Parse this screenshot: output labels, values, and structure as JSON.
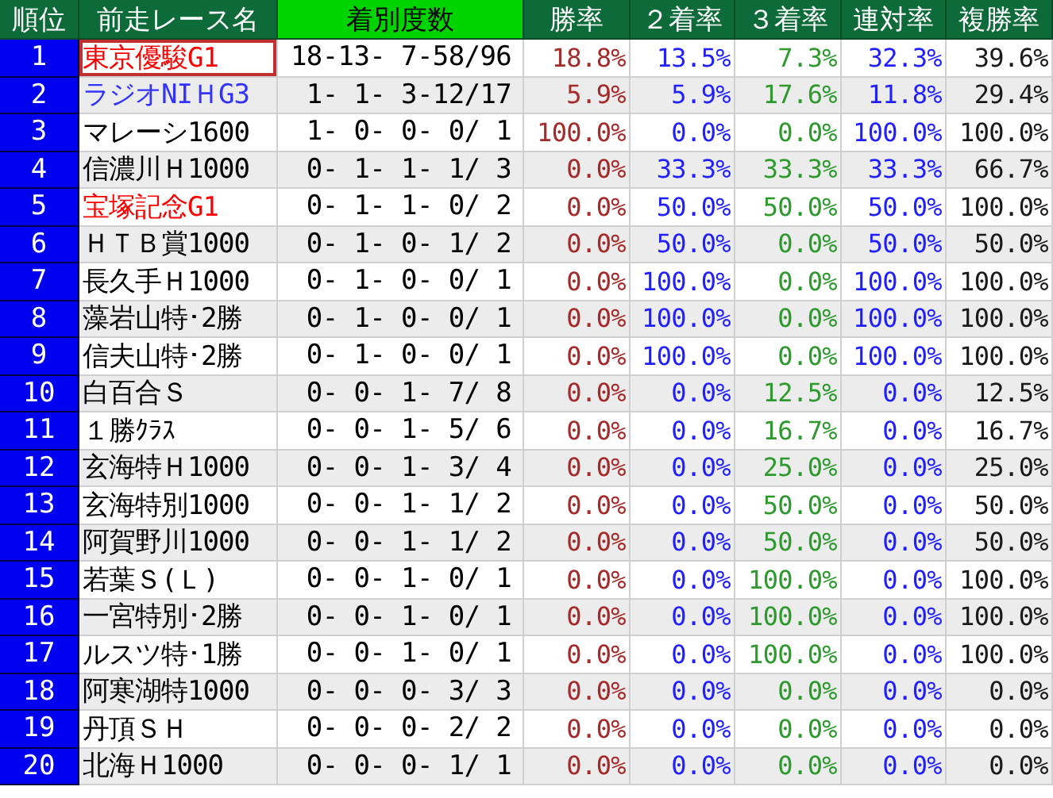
{
  "columns": [
    {
      "label": "順位",
      "sorted": false
    },
    {
      "label": "前走レース名",
      "sorted": false
    },
    {
      "label": "着別度数",
      "sorted": true
    },
    {
      "label": "勝率",
      "sorted": false,
      "color": "#a52a2a"
    },
    {
      "label": "２着率",
      "sorted": false,
      "color": "#1f1fff"
    },
    {
      "label": "３着率",
      "sorted": false,
      "color": "#2e9a2e"
    },
    {
      "label": "連対率",
      "sorted": false,
      "color": "#1f1fff"
    },
    {
      "label": "複勝率",
      "sorted": false,
      "color": "#1a1a1a"
    }
  ],
  "rows": [
    {
      "rank": "1",
      "name": "東京優駿G1",
      "color": "#ff0000",
      "selected": true,
      "record": "18-13- 7-58/96",
      "rates": [
        "18.8%",
        "13.5%",
        "7.3%",
        "32.3%",
        "39.6%"
      ]
    },
    {
      "rank": "2",
      "name": "ラジオNIＨG3",
      "color": "#3333ff",
      "selected": false,
      "record": " 1- 1- 3-12/17",
      "rates": [
        "5.9%",
        "5.9%",
        "17.6%",
        "11.8%",
        "29.4%"
      ]
    },
    {
      "rank": "3",
      "name": "マレーシ1600",
      "color": "#000000",
      "selected": false,
      "record": " 1- 0- 0- 0/ 1",
      "rates": [
        "100.0%",
        "0.0%",
        "0.0%",
        "100.0%",
        "100.0%"
      ]
    },
    {
      "rank": "4",
      "name": "信濃川Ｈ1000",
      "color": "#000000",
      "selected": false,
      "record": " 0- 1- 1- 1/ 3",
      "rates": [
        "0.0%",
        "33.3%",
        "33.3%",
        "33.3%",
        "66.7%"
      ]
    },
    {
      "rank": "5",
      "name": "宝塚記念G1",
      "color": "#ff0000",
      "selected": false,
      "record": " 0- 1- 1- 0/ 2",
      "rates": [
        "0.0%",
        "50.0%",
        "50.0%",
        "50.0%",
        "100.0%"
      ]
    },
    {
      "rank": "6",
      "name": "ＨＴＢ賞1000",
      "color": "#000000",
      "selected": false,
      "record": " 0- 1- 0- 1/ 2",
      "rates": [
        "0.0%",
        "50.0%",
        "0.0%",
        "50.0%",
        "50.0%"
      ]
    },
    {
      "rank": "7",
      "name": "長久手Ｈ1000",
      "color": "#000000",
      "selected": false,
      "record": " 0- 1- 0- 0/ 1",
      "rates": [
        "0.0%",
        "100.0%",
        "0.0%",
        "100.0%",
        "100.0%"
      ]
    },
    {
      "rank": "8",
      "name": "藻岩山特･2勝",
      "color": "#000000",
      "selected": false,
      "record": " 0- 1- 0- 0/ 1",
      "rates": [
        "0.0%",
        "100.0%",
        "0.0%",
        "100.0%",
        "100.0%"
      ]
    },
    {
      "rank": "9",
      "name": "信夫山特･2勝",
      "color": "#000000",
      "selected": false,
      "record": " 0- 1- 0- 0/ 1",
      "rates": [
        "0.0%",
        "100.0%",
        "0.0%",
        "100.0%",
        "100.0%"
      ]
    },
    {
      "rank": "10",
      "name": "白百合Ｓ",
      "color": "#000000",
      "selected": false,
      "record": " 0- 0- 1- 7/ 8",
      "rates": [
        "0.0%",
        "0.0%",
        "12.5%",
        "0.0%",
        "12.5%"
      ]
    },
    {
      "rank": "11",
      "name": "１勝ｸﾗｽ",
      "color": "#000000",
      "selected": false,
      "record": " 0- 0- 1- 5/ 6",
      "rates": [
        "0.0%",
        "0.0%",
        "16.7%",
        "0.0%",
        "16.7%"
      ]
    },
    {
      "rank": "12",
      "name": "玄海特Ｈ1000",
      "color": "#000000",
      "selected": false,
      "record": " 0- 0- 1- 3/ 4",
      "rates": [
        "0.0%",
        "0.0%",
        "25.0%",
        "0.0%",
        "25.0%"
      ]
    },
    {
      "rank": "13",
      "name": "玄海特別1000",
      "color": "#000000",
      "selected": false,
      "record": " 0- 0- 1- 1/ 2",
      "rates": [
        "0.0%",
        "0.0%",
        "50.0%",
        "0.0%",
        "50.0%"
      ]
    },
    {
      "rank": "14",
      "name": "阿賀野川1000",
      "color": "#000000",
      "selected": false,
      "record": " 0- 0- 1- 1/ 2",
      "rates": [
        "0.0%",
        "0.0%",
        "50.0%",
        "0.0%",
        "50.0%"
      ]
    },
    {
      "rank": "15",
      "name": "若葉Ｓ(Ｌ)",
      "color": "#000000",
      "selected": false,
      "record": " 0- 0- 1- 0/ 1",
      "rates": [
        "0.0%",
        "0.0%",
        "100.0%",
        "0.0%",
        "100.0%"
      ]
    },
    {
      "rank": "16",
      "name": "一宮特別･2勝",
      "color": "#000000",
      "selected": false,
      "record": " 0- 0- 1- 0/ 1",
      "rates": [
        "0.0%",
        "0.0%",
        "100.0%",
        "0.0%",
        "100.0%"
      ]
    },
    {
      "rank": "17",
      "name": "ルスツ特･1勝",
      "color": "#000000",
      "selected": false,
      "record": " 0- 0- 1- 0/ 1",
      "rates": [
        "0.0%",
        "0.0%",
        "100.0%",
        "0.0%",
        "100.0%"
      ]
    },
    {
      "rank": "18",
      "name": "阿寒湖特1000",
      "color": "#000000",
      "selected": false,
      "record": " 0- 0- 0- 3/ 3",
      "rates": [
        "0.0%",
        "0.0%",
        "0.0%",
        "0.0%",
        "0.0%"
      ]
    },
    {
      "rank": "19",
      "name": "丹頂ＳＨ",
      "color": "#000000",
      "selected": false,
      "record": " 0- 0- 0- 2/ 2",
      "rates": [
        "0.0%",
        "0.0%",
        "0.0%",
        "0.0%",
        "0.0%"
      ]
    },
    {
      "rank": "20",
      "name": "北海Ｈ1000",
      "color": "#000000",
      "selected": false,
      "record": " 0- 0- 0- 1/ 1",
      "rates": [
        "0.0%",
        "0.0%",
        "0.0%",
        "0.0%",
        "0.0%"
      ]
    }
  ]
}
